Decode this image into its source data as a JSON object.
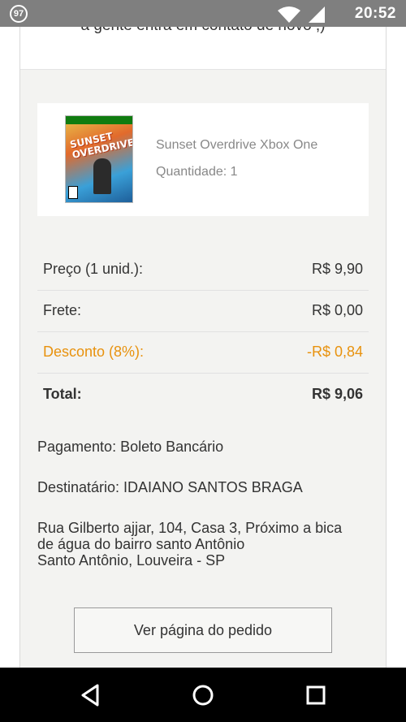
{
  "status_bar": {
    "badge": "97",
    "time": "20:52",
    "icons": [
      "wifi-icon",
      "signal-icon"
    ]
  },
  "top_message": "a gente entra em contato de novo ;)",
  "product": {
    "cover_title": "SUNSET OVERDRIVE",
    "name": "Sunset Overdrive Xbox One",
    "quantity": "Quantidade: 1"
  },
  "summary": {
    "price_label": "Preço (1 unid.):",
    "price_value": "R$ 9,90",
    "shipping_label": "Frete:",
    "shipping_value": "R$ 0,00",
    "discount_label": "Desconto (8%):",
    "discount_value": "-R$ 0,84",
    "total_label": "Total:",
    "total_value": "R$ 9,06"
  },
  "payment": "Pagamento: Boleto Bancário",
  "recipient": "Destinatário: IDAIANO SANTOS BRAGA",
  "address": {
    "line1": "Rua Gilberto ajjar, 104, Casa 3, Próximo a bica",
    "line2": "de água do bairro santo Antônio",
    "line3": "Santo Antônio, Louveira - SP"
  },
  "button_label": "Ver página do pedido",
  "colors": {
    "discount": "#e8920e",
    "summary_bg": "#f3f3f1",
    "status_bar": "#7f7f7f",
    "nav_bar": "#000000"
  },
  "nav_bar": [
    "back-icon",
    "home-icon",
    "recents-icon"
  ]
}
